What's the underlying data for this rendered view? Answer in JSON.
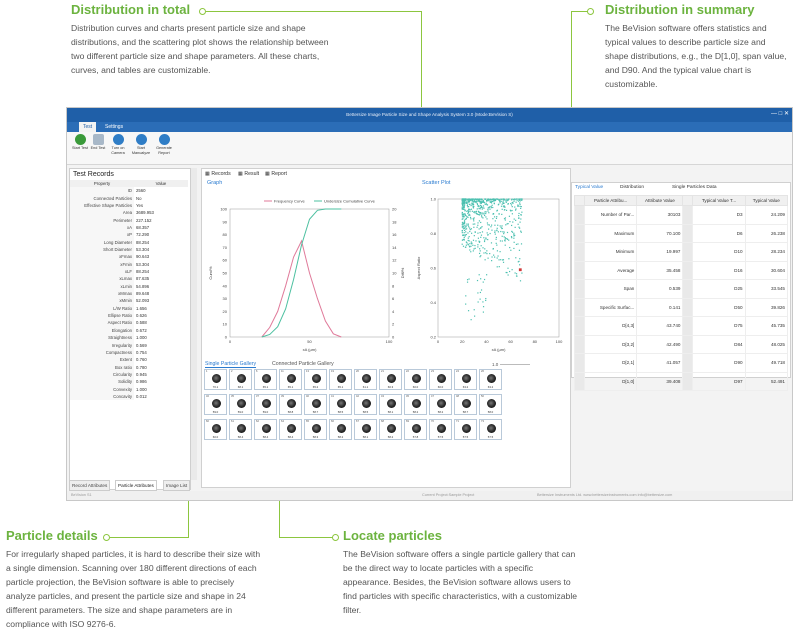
{
  "sections": {
    "distribution_total": {
      "title": "Distribution in total",
      "text": "Distribution curves and charts present particle size and shape distributions, and the scattering plot shows the relationship between two different particle size and shape parameters. All these charts, curves, and tables are customizable."
    },
    "distribution_summary": {
      "title": "Distribution in summary",
      "text": "The BeVision software offers statistics and typical values to describe particle size and shape distributions, e.g., the D[1,0], span value,  and D90. And the typical value chart is customizable."
    },
    "particle_details": {
      "title": "Particle details",
      "text": "For irregularly shaped particles, it is hard to describe their size with a single dimension. Scanning over 180 different directions of each particle projection, the BeVision software is able to precisely analyze particles, and present the particle size and shape in 24 different parameters. The size and shape parameters are in compliance with ISO 9276-6."
    },
    "locate_particles": {
      "title": "Locate particles",
      "text": "The BeVision software offers a single particle gallery that can be the direct way to locate particles with a specific appearance. Besides, the BeVision software allows users to find particles with specific characteristics, with a customizable filter."
    }
  },
  "app": {
    "title": "Bettersize Image Particle Size and Shape Analysis System 3.0 (Mode:BeVision S)",
    "menu_tabs": [
      "Test",
      "Settings"
    ],
    "ribbon": [
      {
        "label": "Start Test",
        "color": "#3a9a3a"
      },
      {
        "label": "End Test",
        "color": "#a8b8c8"
      },
      {
        "label": "Turn on Camera",
        "color": "#2f7dc6"
      },
      {
        "label": "Start Manualyze",
        "color": "#2f7dc6"
      },
      {
        "label": "Generate Report",
        "color": "#2f7dc6"
      }
    ],
    "left_panel": {
      "title": "Test Records",
      "columns": [
        "Property",
        "Value"
      ],
      "rows": [
        [
          "ID",
          "2560"
        ],
        [
          "Connected Particles",
          "No"
        ],
        [
          "Effective Shape Particles",
          "Yes"
        ],
        [
          "Area",
          "3689.953"
        ],
        [
          "Perimeter",
          "227.152"
        ],
        [
          "xA",
          "68.357"
        ],
        [
          "xP",
          "72.290"
        ],
        [
          "Long Diameter",
          "88.254"
        ],
        [
          "Short Diameter",
          "53.304"
        ],
        [
          "xFmax",
          "90.643"
        ],
        [
          "xFmin",
          "53.304"
        ],
        [
          "xLF",
          "88.254"
        ],
        [
          "xLmax",
          "87.635"
        ],
        [
          "xLmin",
          "54.896"
        ],
        [
          "xMmax",
          "89.648"
        ],
        [
          "xMmin",
          "52.093"
        ],
        [
          "L/W Ratio",
          "1.656"
        ],
        [
          "Ellipse Ratio",
          "0.626"
        ],
        [
          "Aspect Ratio",
          "0.588"
        ],
        [
          "Elongation",
          "0.672"
        ],
        [
          "Straightness",
          "1.000"
        ],
        [
          "Irregularity",
          "0.569"
        ],
        [
          "Compactness",
          "0.754"
        ],
        [
          "Extent",
          "0.760"
        ],
        [
          "Box ratio",
          "0.780"
        ],
        [
          "Circularity",
          "0.945"
        ],
        [
          "Solidity",
          "0.986"
        ],
        [
          "Convexity",
          "1.000"
        ],
        [
          "Concavity",
          "0.012"
        ]
      ],
      "bottom_tabs": [
        "Record Attributes",
        "Particle Attributes",
        "Image List"
      ]
    },
    "center": {
      "tabs": [
        "Records",
        "Result",
        "Report"
      ],
      "graph_title": "Graph",
      "scatter_title": "Scatter Plot",
      "gallery_tabs": [
        "Single Particle Gallery",
        "Connected Particle Gallery"
      ],
      "gallery_zoom": "1.0"
    },
    "right_panel": {
      "tabs": [
        "Typical Value",
        "Distribution",
        "Single Particles Data"
      ],
      "columns": [
        "Particle Attribu...",
        "Attribute Value",
        "Typical Value T...",
        "Typical Value"
      ],
      "rows": [
        [
          "Number of Par...",
          "30103",
          "D3",
          "24.209"
        ],
        [
          "Maximum",
          "70.100",
          "D6",
          "26.238"
        ],
        [
          "Minimum",
          "19.997",
          "D10",
          "28.234"
        ],
        [
          "Average",
          "35.458",
          "D16",
          "30.604"
        ],
        [
          "Span",
          "0.539",
          "D25",
          "33.545"
        ],
        [
          "Specific Surfac...",
          "0.141",
          "D50",
          "39.826"
        ],
        [
          "D[4,3]",
          "43.740",
          "D75",
          "45.735"
        ],
        [
          "D[3,2]",
          "42.490",
          "D84",
          "48.025"
        ],
        [
          "D[2,1]",
          "41.057",
          "D90",
          "49.718"
        ],
        [
          "D[1,0]",
          "39.408",
          "D97",
          "52.491"
        ]
      ]
    },
    "status": {
      "left": "BeVision S1",
      "mid": "Current Project:Sample Project",
      "right": "Bettersize Instruments Ltd.      www.bettersizeinstruments.com      info@bettersize.com"
    }
  },
  "gallery": {
    "ids": [
      [
        "1",
        "2",
        "6",
        "11",
        "13",
        "19",
        "20",
        "21",
        "22",
        "23",
        "24",
        "26"
      ],
      [
        "32",
        "35",
        "37",
        "39",
        "40",
        "41",
        "42",
        "43",
        "45",
        "47",
        "48",
        "50"
      ],
      [
        "60",
        "61",
        "62",
        "64",
        "65",
        "66",
        "67",
        "68",
        "69",
        "70",
        "71",
        "73"
      ]
    ],
    "values": [
      [
        "70.1",
        "68.1",
        "65.1",
        "65.1",
        "65.2",
        "65.1",
        "61.1",
        "60.3",
        "60.0",
        "60.0",
        "63.2",
        "63.2"
      ],
      [
        "59.0",
        "59.0",
        "59.0",
        "58.8",
        "58.7",
        "58.5",
        "58.5",
        "58.1",
        "58.2",
        "58.2",
        "58.7",
        "58.0"
      ],
      [
        "60.0",
        "58.4",
        "58.4",
        "58.4",
        "58.3",
        "58.2",
        "58.1",
        "58.2",
        "57.8",
        "57.5",
        "57.5",
        "57.5"
      ]
    ]
  },
  "chart_data": [
    {
      "type": "line",
      "title": "",
      "legend": [
        "Frequency Curve",
        "Undersize Cumulative Curve"
      ],
      "legend_position": "top",
      "xlabel": "xA (µm)",
      "ylabel_left": "Cum/%",
      "ylabel_right": "Diff/%",
      "xlim": [
        0,
        100
      ],
      "ylim_left": [
        0,
        100
      ],
      "ylim_right": [
        0,
        20
      ],
      "x_ticks": [
        0,
        50,
        100
      ],
      "y_ticks_left": [
        0,
        10,
        20,
        30,
        40,
        50,
        60,
        70,
        80,
        90,
        100
      ],
      "y_ticks_right": [
        0,
        2,
        4,
        6,
        8,
        10,
        12,
        14,
        16,
        18,
        20
      ],
      "series": [
        {
          "name": "Frequency Curve",
          "color": "#e07a9a",
          "x": [
            20,
            25,
            30,
            35,
            40,
            45,
            50,
            55,
            60,
            65,
            70
          ],
          "y": [
            0,
            1.5,
            4,
            8,
            12.5,
            15,
            10,
            6,
            2.5,
            0.5,
            0
          ]
        },
        {
          "name": "Undersize Cumulative Curve",
          "color": "#4cc0a0",
          "x": [
            20,
            25,
            30,
            35,
            40,
            45,
            50,
            55,
            60,
            65,
            70
          ],
          "y": [
            0,
            2,
            8,
            22,
            45,
            72,
            92,
            99,
            100,
            100,
            100
          ]
        }
      ]
    },
    {
      "type": "scatter",
      "title": "",
      "xlabel": "xA (µm)",
      "ylabel": "Aspect Ratio",
      "xlim": [
        0,
        100
      ],
      "ylim": [
        0.2,
        1.0
      ],
      "x_ticks": [
        0,
        20,
        40,
        60,
        80,
        100
      ],
      "y_ticks": [
        0.2,
        0.4,
        0.6,
        0.8,
        1.0
      ],
      "color": "#4cc0b0",
      "highlight": {
        "x": 68,
        "y": 0.59,
        "color": "#d03a3a"
      },
      "cloud": {
        "x_range": [
          20,
          70
        ],
        "y_range": [
          0.5,
          1.0
        ]
      }
    }
  ]
}
